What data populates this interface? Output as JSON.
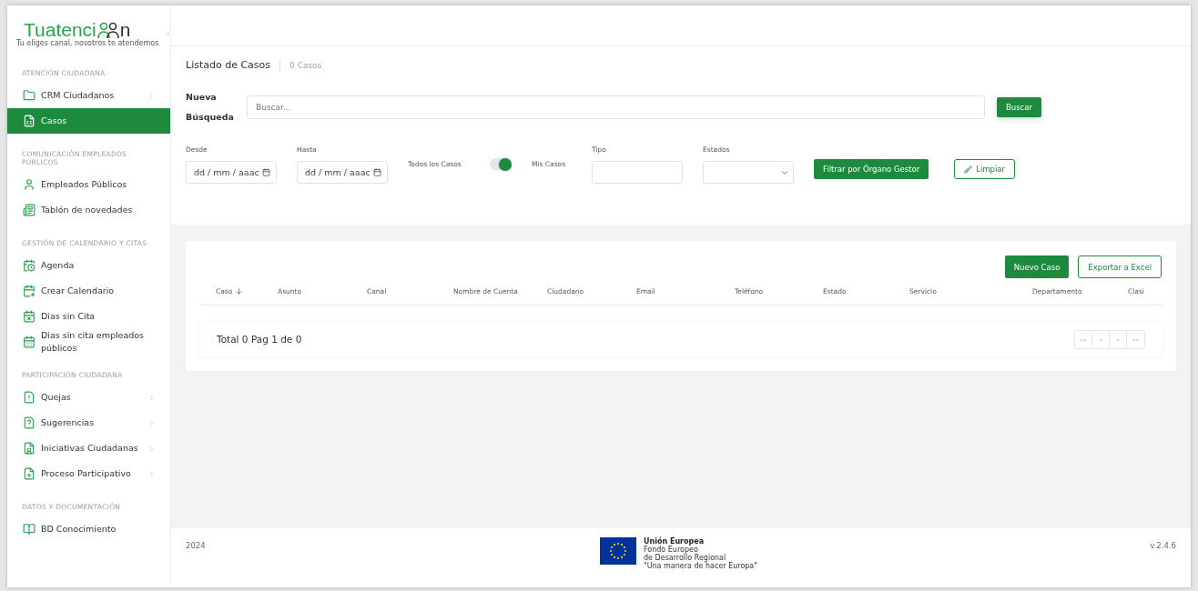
{
  "logo": {
    "text_start": "Tuatenci",
    "text_end": "n",
    "tagline": "Tu eliges canal, nosotros te atendemos"
  },
  "sidebar": {
    "sections": [
      {
        "title": "ATENCIÓN CIUDADANA",
        "items": [
          {
            "label": "CRM Ciudadanos",
            "has_submenu": true,
            "selected": false
          },
          {
            "label": "Casos",
            "has_submenu": false,
            "selected": true
          }
        ]
      },
      {
        "title": "COMUNICACIÓN EMPLEADOS PÚBLICOS",
        "items": [
          {
            "label": "Empleados Públicos",
            "has_submenu": false,
            "selected": false
          },
          {
            "label": "Tablón de novedades",
            "has_submenu": false,
            "selected": false
          }
        ]
      },
      {
        "title": "GESTIÓN DE CALENDARIO Y CITAS",
        "items": [
          {
            "label": "Agenda",
            "has_submenu": false,
            "selected": false
          },
          {
            "label": "Crear Calendario",
            "has_submenu": false,
            "selected": false
          },
          {
            "label": "Dias sin Cita",
            "has_submenu": false,
            "selected": false
          },
          {
            "label": "Dias sin cita empleados públicos",
            "has_submenu": false,
            "selected": false
          }
        ]
      },
      {
        "title": "PARTICIPACIÓN CIUDADANA",
        "items": [
          {
            "label": "Quejas",
            "has_submenu": true,
            "selected": false
          },
          {
            "label": "Sugerencias",
            "has_submenu": true,
            "selected": false
          },
          {
            "label": "Iniciativas Ciudadanas",
            "has_submenu": true,
            "selected": false
          },
          {
            "label": "Proceso Participativo",
            "has_submenu": true,
            "selected": false
          }
        ]
      },
      {
        "title": "DATOS Y DOCUMENTACIÓN",
        "items": [
          {
            "label": "BD Conocimiento",
            "has_submenu": false,
            "selected": false
          }
        ]
      }
    ]
  },
  "page": {
    "title": "Listado de Casos",
    "count": "0 Casos"
  },
  "search": {
    "label": "Nueva Búsqueda",
    "placeholder": "Buscar...",
    "button": "Buscar"
  },
  "filters": {
    "from": {
      "label": "Desde",
      "placeholder": "dd / mm / aaac"
    },
    "to": {
      "label": "Hasta",
      "placeholder": "dd / mm / aaac"
    },
    "toggle": {
      "left_label": "Todos los Casos",
      "right_label": "Mis Casos",
      "on": true
    },
    "type": {
      "label": "Tipo"
    },
    "states": {
      "label": "Estados"
    },
    "filter_button": "Filtrar por Órgano Gestor",
    "clear_button": "Limpiar"
  },
  "table": {
    "actions": [
      "Nuevo Caso",
      "Exportar a Excel"
    ],
    "columns": [
      {
        "label": "Caso",
        "sorted": true
      },
      {
        "label": "Asunto",
        "sorted": false
      },
      {
        "label": "Canal",
        "sorted": false
      },
      {
        "label": "Nombre de Cuenta",
        "sorted": false
      },
      {
        "label": "Ciudadano",
        "sorted": false
      },
      {
        "label": "Email",
        "sorted": false
      },
      {
        "label": "Teléfono",
        "sorted": false
      },
      {
        "label": "Estado",
        "sorted": false
      },
      {
        "label": "Servicio",
        "sorted": false
      },
      {
        "label": "Departamento",
        "sorted": false
      },
      {
        "label": "Clasi",
        "sorted": false
      }
    ],
    "total": "Total 0 Pag 1 de 0",
    "pagination": [
      "««",
      "«",
      "»",
      "»»"
    ]
  },
  "footer": {
    "year": "2024",
    "eu_title": "Unión Europea",
    "eu_lines": [
      "Fondo Europeo",
      "de Desarrollo Regional",
      "\"Una manera de hacer Europa\""
    ],
    "version": "v.2.4.6"
  }
}
